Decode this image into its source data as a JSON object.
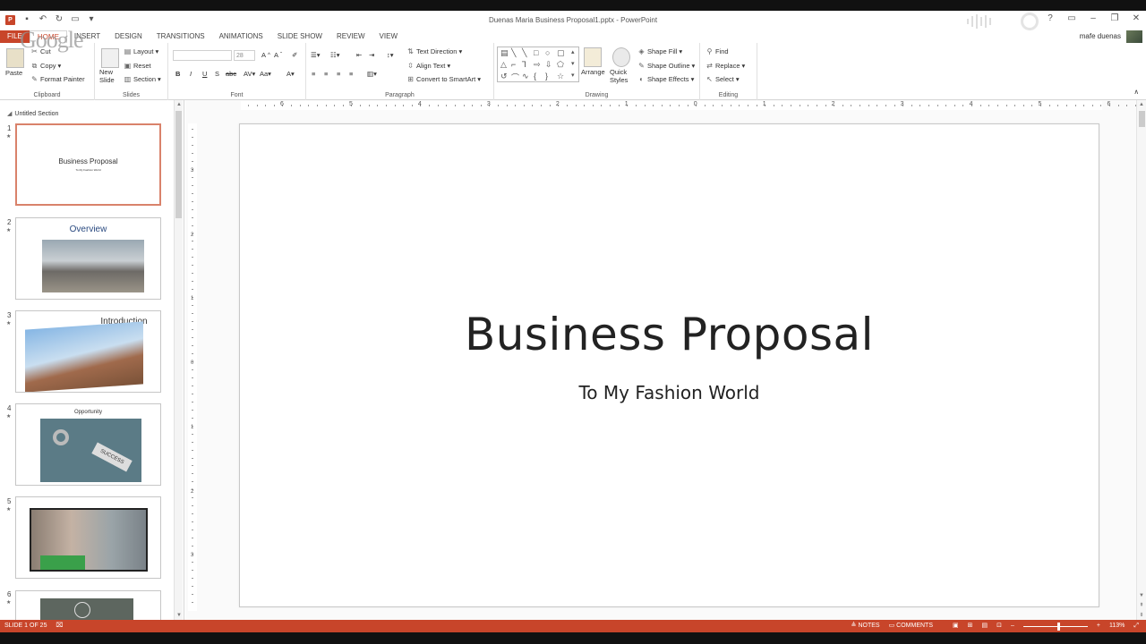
{
  "window": {
    "title": "Duenas Maria Business Proposal1.pptx - PowerPoint",
    "user_name": "mafe duenas",
    "watermark": "Google"
  },
  "tabs": [
    {
      "label": "FILE"
    },
    {
      "label": "HOME"
    },
    {
      "label": "INSERT"
    },
    {
      "label": "DESIGN"
    },
    {
      "label": "TRANSITIONS"
    },
    {
      "label": "ANIMATIONS"
    },
    {
      "label": "SLIDE SHOW"
    },
    {
      "label": "REVIEW"
    },
    {
      "label": "VIEW"
    }
  ],
  "ribbon": {
    "clipboard": {
      "paste": "Paste",
      "cut": "Cut",
      "copy": "Copy",
      "format_painter": "Format Painter",
      "label": "Clipboard"
    },
    "slides": {
      "new_slide": "New Slide",
      "layout": "Layout",
      "reset": "Reset",
      "section": "Section",
      "label": "Slides"
    },
    "font": {
      "font_name": "",
      "font_size": "28",
      "label": "Font"
    },
    "paragraph": {
      "text_direction": "Text Direction",
      "align_text": "Align Text",
      "convert_smartart": "Convert to SmartArt",
      "label": "Paragraph"
    },
    "drawing": {
      "arrange": "Arrange",
      "quick_styles": "Quick Styles",
      "shape_fill": "Shape Fill",
      "shape_outline": "Shape Outline",
      "shape_effects": "Shape Effects",
      "label": "Drawing"
    },
    "editing": {
      "find": "Find",
      "replace": "Replace",
      "select": "Select",
      "label": "Editing"
    }
  },
  "thumbnail_pane": {
    "section_name": "Untitled Section",
    "slides": [
      {
        "number": "1",
        "title": "Business Proposal",
        "subtitle": "To My Fashion World"
      },
      {
        "number": "2",
        "title": "Overview"
      },
      {
        "number": "3",
        "title": "Introduction"
      },
      {
        "number": "4",
        "title": "Opportunity",
        "image_text": "SUCCESS"
      },
      {
        "number": "5",
        "title": ""
      },
      {
        "number": "6",
        "title": ""
      }
    ]
  },
  "slide": {
    "title": "Business Proposal",
    "subtitle": "To My Fashion World"
  },
  "ruler": {
    "h_labels": [
      "6",
      "5",
      "4",
      "3",
      "2",
      "1",
      "0",
      "1",
      "2",
      "3",
      "4",
      "5",
      "6"
    ],
    "v_labels": [
      "3",
      "2",
      "1",
      "0",
      "1",
      "2",
      "3"
    ]
  },
  "status": {
    "slide_info": "SLIDE 1 OF 25",
    "notes": "NOTES",
    "comments": "COMMENTS",
    "zoom": "113%"
  },
  "colors": {
    "accent": "#c8452a",
    "thumb_selected": "#d9826b"
  }
}
